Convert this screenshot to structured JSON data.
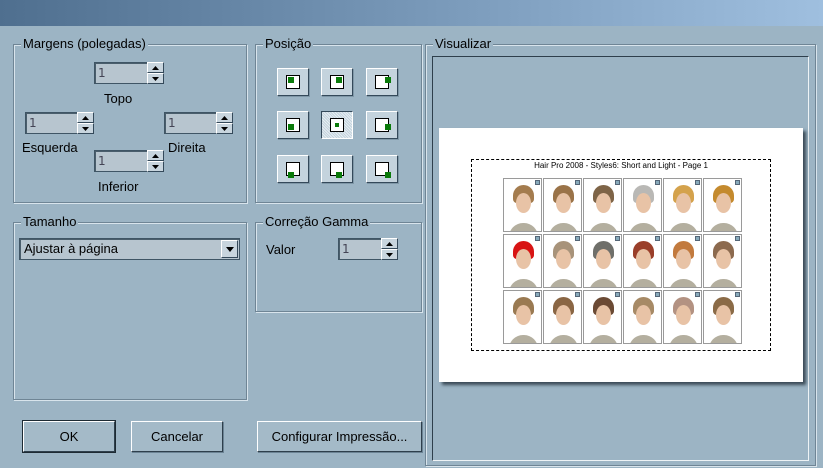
{
  "margins": {
    "legend": "Margens (polegadas)",
    "top_label": "Topo",
    "top_value": "1",
    "left_label": "Esquerda",
    "left_value": "1",
    "right_label": "Direita",
    "right_value": "1",
    "bottom_label": "Inferior",
    "bottom_value": "1"
  },
  "position": {
    "legend": "Posição",
    "selected": "center"
  },
  "size": {
    "legend": "Tamanho",
    "selected": "Ajustar à página"
  },
  "gamma": {
    "legend": "Correção Gamma",
    "value_label": "Valor",
    "value": "1"
  },
  "preview": {
    "legend": "Visualizar",
    "page_title": "Hair Pro 2008 - Styles6: Short and Light - Page 1",
    "hair_colors": [
      "#a47c4e",
      "#9a7348",
      "#7e6447",
      "#b9b8b5",
      "#d4a24c",
      "#c48a2e",
      "#d81414",
      "#a8937a",
      "#6f6f6a",
      "#9a3f2a",
      "#c27a3e",
      "#8c6a4e",
      "#9a7a52",
      "#8a6644",
      "#6b4a34",
      "#a78a66",
      "#b39282",
      "#8b6b47"
    ]
  },
  "buttons": {
    "ok": "OK",
    "cancel": "Cancelar",
    "setup": "Configurar Impressão..."
  },
  "colors": {
    "window_bg": "#9cb4c4",
    "marker": "#0a7a0a"
  }
}
